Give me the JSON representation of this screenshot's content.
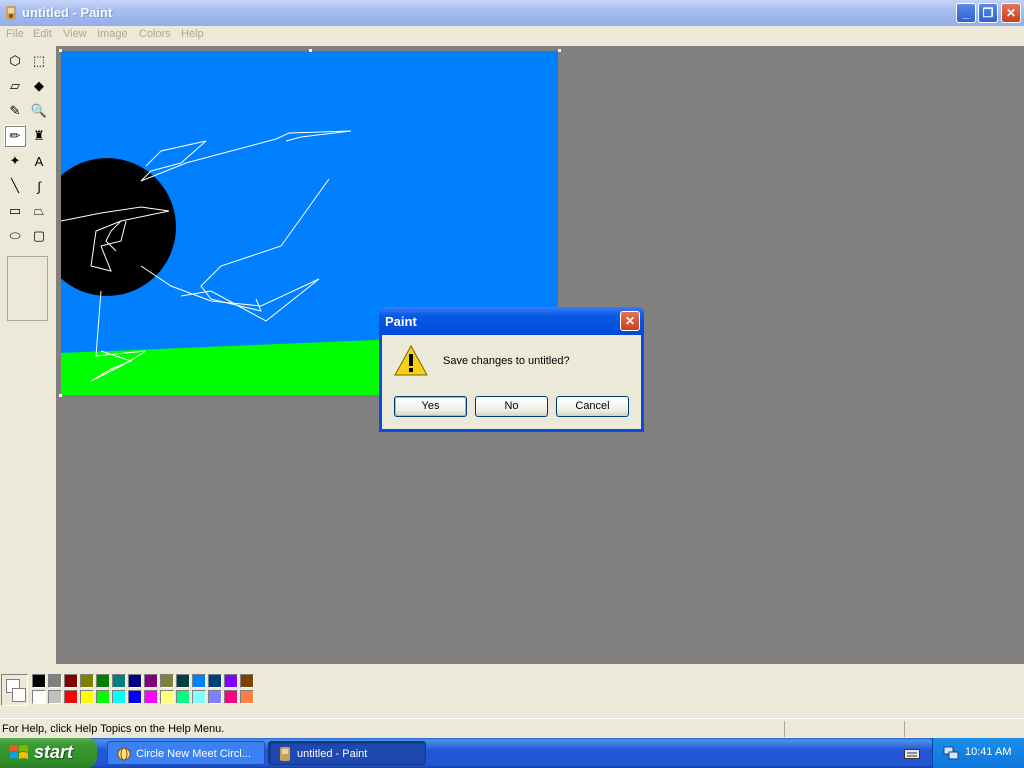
{
  "window": {
    "title": "untitled - Paint"
  },
  "menu": [
    "File",
    "Edit",
    "View",
    "Image",
    "Colors",
    "Help"
  ],
  "tools": [
    {
      "name": "free-form-select-icon",
      "glyph": "⬡"
    },
    {
      "name": "select-icon",
      "glyph": "⬚"
    },
    {
      "name": "eraser-icon",
      "glyph": "▱"
    },
    {
      "name": "fill-icon",
      "glyph": "◆"
    },
    {
      "name": "pick-color-icon",
      "glyph": "✎"
    },
    {
      "name": "magnifier-icon",
      "glyph": "🔍"
    },
    {
      "name": "pencil-icon",
      "glyph": "✏"
    },
    {
      "name": "brush-icon",
      "glyph": "♜"
    },
    {
      "name": "airbrush-icon",
      "glyph": "✦"
    },
    {
      "name": "text-icon",
      "glyph": "A"
    },
    {
      "name": "line-icon",
      "glyph": "╲"
    },
    {
      "name": "curve-icon",
      "glyph": "∫"
    },
    {
      "name": "rectangle-icon",
      "glyph": "▭"
    },
    {
      "name": "polygon-icon",
      "glyph": "⏢"
    },
    {
      "name": "ellipse-icon",
      "glyph": "⬭"
    },
    {
      "name": "rounded-rectangle-icon",
      "glyph": "▢"
    }
  ],
  "dialog": {
    "title": "Paint",
    "message": "Save changes to untitled?",
    "yes": "Yes",
    "no": "No",
    "cancel": "Cancel",
    "icon": "warning-icon"
  },
  "palette": {
    "row1": [
      "#000000",
      "#808080",
      "#800000",
      "#808000",
      "#008000",
      "#008080",
      "#000080",
      "#800080",
      "#808040",
      "#004040",
      "#0080ff",
      "#004080",
      "#8000ff",
      "#804000"
    ],
    "row2": [
      "#ffffff",
      "#c0c0c0",
      "#ff0000",
      "#ffff00",
      "#00ff00",
      "#00ffff",
      "#0000ff",
      "#ff00ff",
      "#ffff80",
      "#00ff80",
      "#80ffff",
      "#8080ff",
      "#ff0080",
      "#ff8040"
    ]
  },
  "status": {
    "text": "For Help, click Help Topics on the Help Menu."
  },
  "taskbar": {
    "start": "start",
    "tasks": [
      {
        "label": "Circle New Meet Circl...",
        "active": false
      },
      {
        "label": "untitled - Paint",
        "active": true
      }
    ],
    "clock": "10:41 AM"
  },
  "canvas_colors": {
    "sky": "#0080ff",
    "grass": "#00ff00",
    "ball": "#000000",
    "line": "#ffffff"
  }
}
